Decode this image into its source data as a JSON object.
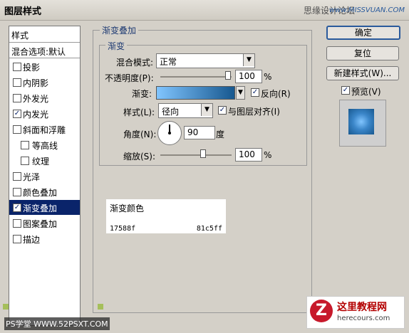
{
  "window": {
    "title": "图层样式"
  },
  "watermark": {
    "top_text": "思缘设计论坛",
    "site": "www.MISSVUAN.COM"
  },
  "styles_panel": {
    "header": "样式",
    "blend_options": "混合选项:默认",
    "items": [
      {
        "label": "投影",
        "checked": false,
        "sub": false,
        "selected": false
      },
      {
        "label": "内阴影",
        "checked": false,
        "sub": false,
        "selected": false
      },
      {
        "label": "外发光",
        "checked": false,
        "sub": false,
        "selected": false
      },
      {
        "label": "内发光",
        "checked": true,
        "sub": false,
        "selected": false
      },
      {
        "label": "斜面和浮雕",
        "checked": false,
        "sub": false,
        "selected": false
      },
      {
        "label": "等高线",
        "checked": false,
        "sub": true,
        "selected": false
      },
      {
        "label": "纹理",
        "checked": false,
        "sub": true,
        "selected": false
      },
      {
        "label": "光泽",
        "checked": false,
        "sub": false,
        "selected": false
      },
      {
        "label": "颜色叠加",
        "checked": false,
        "sub": false,
        "selected": false
      },
      {
        "label": "渐变叠加",
        "checked": true,
        "sub": false,
        "selected": true
      },
      {
        "label": "图案叠加",
        "checked": false,
        "sub": false,
        "selected": false
      },
      {
        "label": "描边",
        "checked": false,
        "sub": false,
        "selected": false
      }
    ]
  },
  "gradient_overlay": {
    "group_title": "渐变叠加",
    "sub_title": "渐变",
    "blend_mode": {
      "label": "混合模式:",
      "value": "正常"
    },
    "opacity": {
      "label": "不透明度(P):",
      "value": "100",
      "unit": "%",
      "level": 1.0
    },
    "gradient": {
      "label": "渐变:",
      "from": "#81c5ff",
      "to": "#17588f"
    },
    "reverse": {
      "label": "反向(R)",
      "checked": true
    },
    "style": {
      "label": "样式(L):",
      "value": "径向"
    },
    "align": {
      "label": "与图层对齐(I)",
      "checked": true
    },
    "angle": {
      "label": "角度(N):",
      "value": "90",
      "unit": "度"
    },
    "scale": {
      "label": "缩放(S):",
      "value": "100",
      "unit": "%",
      "level": 0.5
    }
  },
  "notes": {
    "title": "渐变颜色",
    "color_a": "17588f",
    "color_b": "81c5ff"
  },
  "buttons": {
    "ok": "确定",
    "reset": "复位",
    "new_style": "新建样式(W)...",
    "preview": "预览(V)",
    "preview_checked": true
  },
  "footer": {
    "left_watermark": "PS学堂 WWW.52PSXT.COM",
    "right_logo_char": "Z",
    "right_title": "这里教程网",
    "right_url": "herecours.com"
  }
}
